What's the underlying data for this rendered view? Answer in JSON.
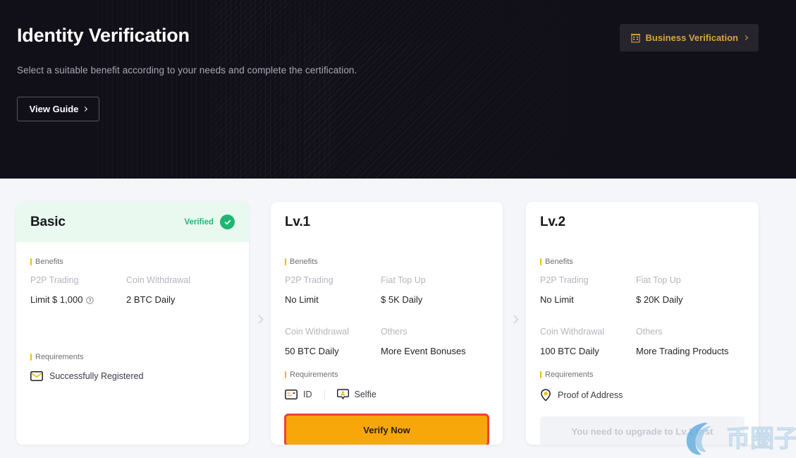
{
  "hero": {
    "title": "Identity Verification",
    "subtitle": "Select a suitable benefit according to your needs and complete the certification.",
    "view_guide_label": "View Guide",
    "business_verification_label": "Business Verification",
    "business_icon": "building-icon",
    "background_color": "#111019",
    "accent_color": "#d9a441"
  },
  "cards": [
    {
      "title": "Basic",
      "status_label": "Verified",
      "status_color": "#21b573",
      "benefits_label": "Benefits",
      "benefits": [
        {
          "key": "P2P Trading",
          "value": "Limit $ 1,000",
          "has_info_icon": true
        },
        {
          "key": "Coin Withdrawal",
          "value": "2 BTC Daily",
          "has_info_icon": false
        }
      ],
      "requirements_label": "Requirements",
      "requirements": [
        {
          "label": "Successfully Registered",
          "icon": "envelope-icon"
        }
      ],
      "cta": null
    },
    {
      "title": "Lv.1",
      "status_label": "",
      "benefits_label": "Benefits",
      "benefits": [
        {
          "key": "P2P Trading",
          "value": "No Limit",
          "has_info_icon": false
        },
        {
          "key": "Fiat Top Up",
          "value": "$ 5K Daily",
          "has_info_icon": false
        },
        {
          "key": "Coin Withdrawal",
          "value": "50 BTC Daily",
          "has_info_icon": false
        },
        {
          "key": "Others",
          "value": "More Event Bonuses",
          "has_info_icon": false
        }
      ],
      "requirements_label": "Requirements",
      "requirements": [
        {
          "label": "ID",
          "icon": "id-card-icon"
        },
        {
          "label": "Selfie",
          "icon": "selfie-icon"
        }
      ],
      "cta": {
        "label": "Verify Now",
        "state": "enabled",
        "color": "#f8a70b",
        "highlight_color": "#ef4136"
      }
    },
    {
      "title": "Lv.2",
      "status_label": "",
      "benefits_label": "Benefits",
      "benefits": [
        {
          "key": "P2P Trading",
          "value": "No Limit",
          "has_info_icon": false
        },
        {
          "key": "Fiat Top Up",
          "value": "$ 20K Daily",
          "has_info_icon": false
        },
        {
          "key": "Coin Withdrawal",
          "value": "100 BTC Daily",
          "has_info_icon": false
        },
        {
          "key": "Others",
          "value": "More Trading Products",
          "has_info_icon": false
        }
      ],
      "requirements_label": "Requirements",
      "requirements": [
        {
          "label": "Proof of Address",
          "icon": "location-pin-icon"
        }
      ],
      "cta": {
        "label": "You need to upgrade to Lv.1 first",
        "state": "disabled"
      }
    }
  ],
  "carousel": {
    "next_icon_1": "chevron-right-icon",
    "next_icon_2": "chevron-right-icon"
  },
  "watermark": {
    "text": "币圈子",
    "color": "#6ab0e0"
  }
}
